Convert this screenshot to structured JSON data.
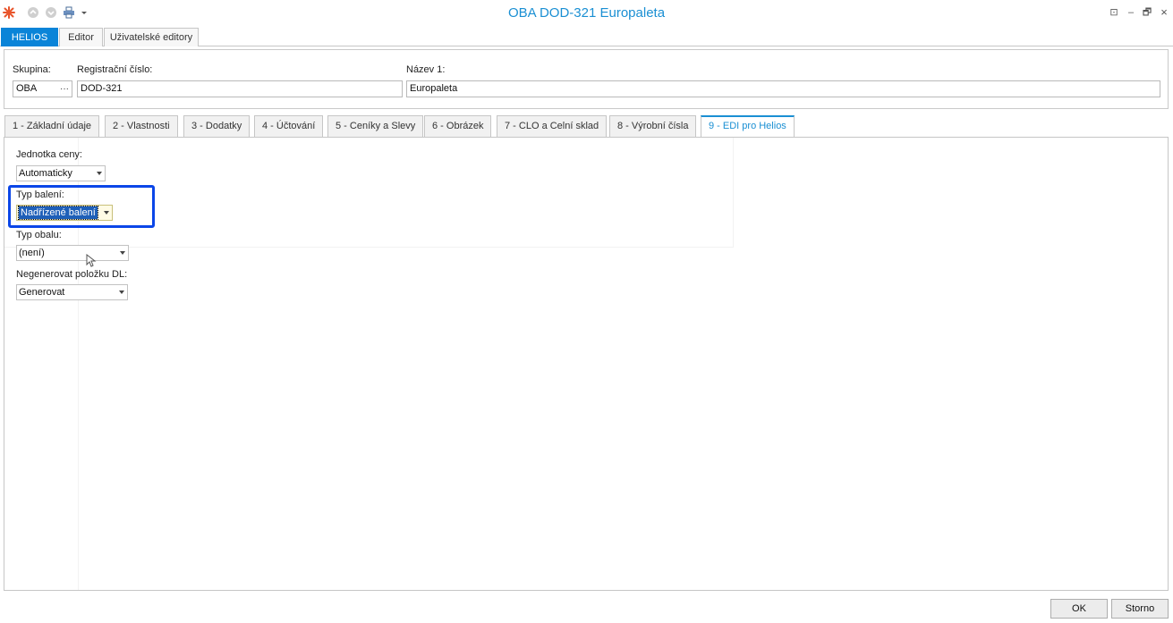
{
  "window": {
    "title": "OBA DOD-321 Europaleta",
    "controls": {
      "restore_view": "⊡",
      "minimize": "–",
      "maximize": "🗗",
      "close": "×"
    }
  },
  "ribbon": {
    "tabs": [
      {
        "label": "HELIOS",
        "active": true
      },
      {
        "label": "Editor",
        "active": false
      },
      {
        "label": "Uživatelské editory",
        "active": false
      }
    ]
  },
  "header": {
    "skupina": {
      "label": "Skupina:",
      "value": "OBA",
      "button": "···"
    },
    "registracni_cislo": {
      "label": "Registrační číslo:",
      "value": "DOD-321"
    },
    "nazev": {
      "label": "Název 1:",
      "value": "Europaleta"
    }
  },
  "tabs": [
    {
      "label": "1 - Základní údaje",
      "active": false
    },
    {
      "label": "2 - Vlastnosti",
      "active": false
    },
    {
      "label": "3 - Dodatky",
      "active": false
    },
    {
      "label": "4 - Účtování",
      "active": false
    },
    {
      "label": "5 - Ceníky a Slevy",
      "active": false
    },
    {
      "label": "6 - Obrázek",
      "active": false
    },
    {
      "label": "7 - CLO a Celní sklad",
      "active": false
    },
    {
      "label": "8 - Výrobní čísla",
      "active": false
    },
    {
      "label": "9 - EDI pro Helios",
      "active": true
    }
  ],
  "form": {
    "jednotka_ceny": {
      "label": "Jednotka ceny:",
      "value": "Automaticky"
    },
    "typ_baleni": {
      "label": "Typ balení:",
      "value": "Nadřízené balení"
    },
    "typ_obalu": {
      "label": "Typ obalu:",
      "value": "(není)"
    },
    "negenerovat": {
      "label": "Negenerovat položku DL:",
      "value": "Generovat"
    }
  },
  "buttons": {
    "ok": "OK",
    "storno": "Storno"
  },
  "colors": {
    "accent": "#0a84d8",
    "highlight_box": "#0b46e8",
    "title": "#1a8fd3"
  }
}
